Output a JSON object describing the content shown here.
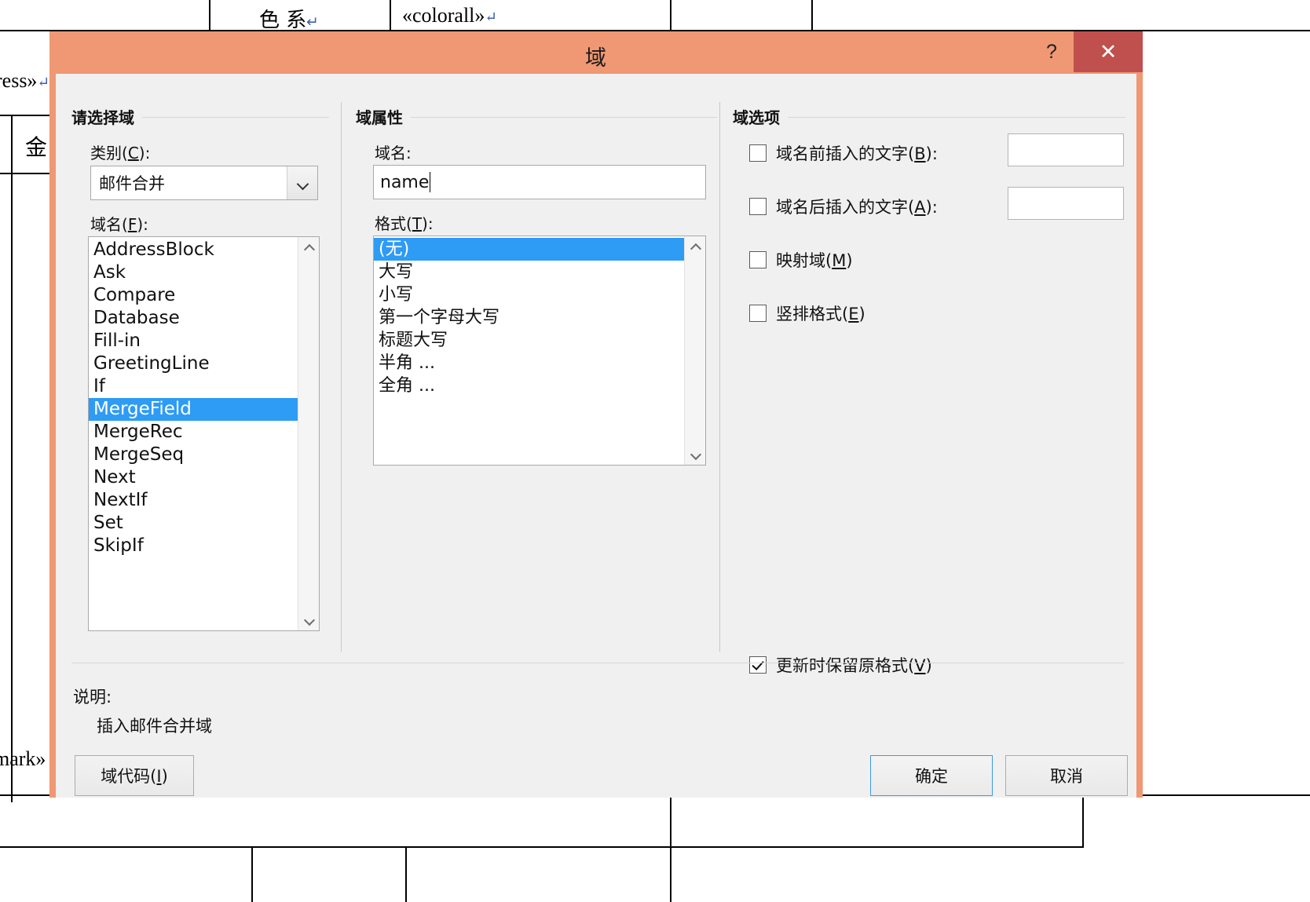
{
  "background_document": {
    "cells": [
      {
        "text": "色    系",
        "pilcrow": true
      },
      {
        "text": "«colorall»",
        "pilcrow": true
      },
      {
        "text": "ress»",
        "pilcrow": true
      },
      {
        "text": "金",
        "pilcrow": false
      },
      {
        "text": "mark»",
        "pilcrow": false
      }
    ]
  },
  "dialog": {
    "title": "域",
    "help_label": "?",
    "close_label": "✕",
    "titlebar_color": "#ef9873",
    "close_button_color": "#c0504d",
    "accent_selection_color": "#2e9bf5",
    "body_color": "#f0f0f0",
    "left_panel": {
      "group_title": "请选择域",
      "category_label_pre": "类别(",
      "category_label_key": "C",
      "category_label_post": "):",
      "category_value": "邮件合并",
      "fieldname_label_pre": "域名(",
      "fieldname_label_key": "F",
      "fieldname_label_post": "):",
      "field_names": [
        "AddressBlock",
        "Ask",
        "Compare",
        "Database",
        "Fill-in",
        "GreetingLine",
        "If",
        "MergeField",
        "MergeRec",
        "MergeSeq",
        "Next",
        "NextIf",
        "Set",
        "SkipIf"
      ],
      "selected_field_name": "MergeField"
    },
    "middle_panel": {
      "group_title": "域属性",
      "fieldname_label": "域名:",
      "fieldname_value": "name",
      "format_label_pre": "格式(",
      "format_label_key": "T",
      "format_label_post": "):",
      "formats": [
        "(无)",
        "大写",
        "小写",
        "第一个字母大写",
        "标题大写",
        "半角 ...",
        "全角 ..."
      ],
      "selected_format": "(无)"
    },
    "right_panel": {
      "group_title": "域选项",
      "options": [
        {
          "label_pre": "域名前插入的文字(",
          "label_key": "B",
          "label_post": "):",
          "checked": false,
          "has_textfield": true,
          "value": ""
        },
        {
          "label_pre": "域名后插入的文字(",
          "label_key": "A",
          "label_post": "):",
          "checked": false,
          "has_textfield": true,
          "value": ""
        },
        {
          "label_pre": "映射域(",
          "label_key": "M",
          "label_post": ")",
          "checked": false,
          "has_textfield": false,
          "value": ""
        },
        {
          "label_pre": "竖排格式(",
          "label_key": "E",
          "label_post": ")",
          "checked": false,
          "has_textfield": false,
          "value": ""
        }
      ],
      "preserve_format": {
        "label_pre": "更新时保留原格式(",
        "label_key": "V",
        "label_post": ")",
        "checked": true
      }
    },
    "description": {
      "title": "说明:",
      "body": "插入邮件合并域"
    },
    "buttons": {
      "field_codes_pre": "域代码(",
      "field_codes_key": "I",
      "field_codes_post": ")",
      "ok": "确定",
      "cancel": "取消"
    }
  }
}
